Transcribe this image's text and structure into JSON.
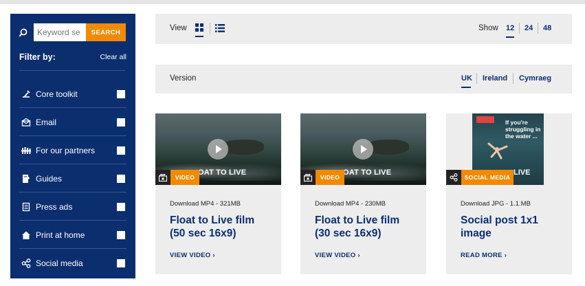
{
  "search": {
    "placeholder": "Keyword se",
    "button_label": "SEARCH"
  },
  "filters": {
    "title": "Filter by:",
    "clear_label": "Clear all",
    "items": [
      {
        "label": "Core toolkit",
        "icon": "toolkit-icon"
      },
      {
        "label": "Email",
        "icon": "email-icon"
      },
      {
        "label": "For our partners",
        "icon": "partners-icon"
      },
      {
        "label": "Guides",
        "icon": "guide-icon"
      },
      {
        "label": "Press ads",
        "icon": "newspaper-icon"
      },
      {
        "label": "Print at home",
        "icon": "house-icon"
      },
      {
        "label": "Social media",
        "icon": "share-icon"
      }
    ]
  },
  "view": {
    "label": "View",
    "active": "grid"
  },
  "show": {
    "label": "Show",
    "options": [
      "12",
      "24",
      "48"
    ],
    "selected": "12"
  },
  "version": {
    "label": "Version",
    "options": [
      "UK",
      "Ireland",
      "Cymraeg"
    ],
    "selected": "UK"
  },
  "cards": [
    {
      "badge": "VIDEO",
      "thumb_caption": "OAT TO LIVE",
      "download": "Download MP4 - 321MB",
      "title_line1": "Float to Live film",
      "title_line2": "(50 sec 16x9)",
      "cta": "VIEW VIDEO  ›"
    },
    {
      "badge": "VIDEO",
      "thumb_caption": "OAT TO LIVE",
      "download": "Download MP4 - 230MB",
      "title_line1": "Float to Live film",
      "title_line2": "(30 sec 16x9)",
      "cta": "VIEW VIDEO  ›"
    },
    {
      "badge": "SOCIAL MEDIA",
      "thumb_caption": "LIVE",
      "poster_text": "If you're struggling in the water ...",
      "download": "Download JPG - 1.1.MB",
      "title_line1": "Social post 1x1",
      "title_line2": "image",
      "cta": "READ MORE  ›"
    }
  ],
  "colors": {
    "navy": "#0b2e6f",
    "orange": "#f18a00",
    "panel": "#ededed"
  }
}
